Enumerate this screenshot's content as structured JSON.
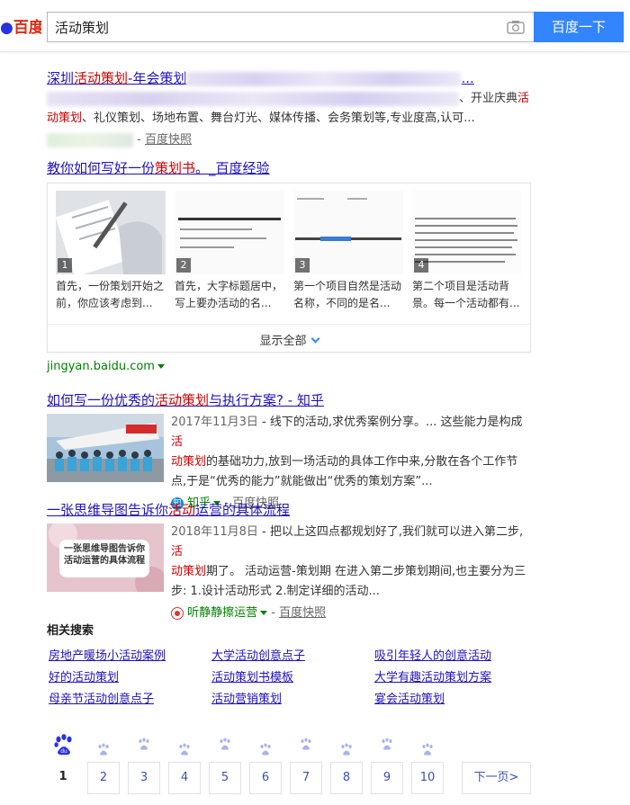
{
  "header": {
    "logo_text": "百度",
    "search_value": "活动策划",
    "search_button": "百度一下"
  },
  "result1": {
    "title_a": "深圳",
    "title_hl": "活动策划",
    "title_b": "-年会策划",
    "title_tail": "...",
    "abs_a": "、开业庆典",
    "abs_hl_a": "活",
    "abs_hl_b": "动策划",
    "abs_b": "、礼仪策划、场地布置、舞台灯光、媒体传播、会务策划等,专业度高,认可...",
    "meta_sep": "-",
    "kuaizhao": "百度快照"
  },
  "result2": {
    "title_a": "教你如何写好一份",
    "title_hl": "策划书",
    "title_b": "。_百度经验",
    "steps": [
      {
        "num": "1",
        "text": "首先，一份策划开始之前，你应该考虑到..."
      },
      {
        "num": "2",
        "text": "首先，大字标题居中，写上要办活动的名..."
      },
      {
        "num": "3",
        "text": "第一个项目自然是活动名称，不同的是名..."
      },
      {
        "num": "4",
        "text": "第二个项目是活动背景。每一个活动都有..."
      }
    ],
    "show_all": "显示全部",
    "url": "jingyan.baidu.com"
  },
  "result3": {
    "title_a": "如何写一份优秀的",
    "title_hl": "活动策划",
    "title_b": "与执行方案? - 知乎",
    "date": "2017年11月3日",
    "abs_a": " - 线下的活动,求优秀案例分享。... 这些能力是构成",
    "abs_hl_a": "活",
    "abs_hl_b": "动策划",
    "abs_b": "的基础功力,放到一场活动的具体工作中来,分散在各个工作节点,于是“优秀的能力”就能做出“优秀的策划方案”...",
    "source": "知乎",
    "source_icon": "知",
    "meta_sep": "-",
    "kuaizhao": "百度快照"
  },
  "result4": {
    "title_a": "一张思维导图告诉你",
    "title_hl": "活动",
    "title_b": "运营的具体流程",
    "date": "2018年11月8日",
    "abs_a": " - 把以上这四点都规划好了,我们就可以进入第二步,",
    "abs_hl_a": "活",
    "abs_hl_b": "动策划",
    "abs_b": "期了。 活动运营-策划期 在进入第二步策划期间,也主要分为三步: 1.设计活动形式 2.制定详细的活动...",
    "source": "听静静擦运营",
    "meta_sep": "-",
    "kuaizhao": "百度快照",
    "thumb_text": "一张思维导图告诉你活动运营的具体流程"
  },
  "related": {
    "title": "相关搜索",
    "items": [
      "房地产暖场小活动案例",
      "大学活动创意点子",
      "吸引年轻人的创意活动",
      "好的活动策划",
      "活动策划书模板",
      "大学有趣活动策划方案",
      "母亲节活动创意点子",
      "活动营销策划",
      "宴会活动策划"
    ]
  },
  "pagination": {
    "pages": [
      "1",
      "2",
      "3",
      "4",
      "5",
      "6",
      "7",
      "8",
      "9",
      "10"
    ],
    "next": "下一页>"
  },
  "colors": {
    "link": "#2011be",
    "highlight": "#cc0000",
    "url_green": "#008000",
    "brand_blue": "#3385ff",
    "logo_red": "#de2910"
  }
}
